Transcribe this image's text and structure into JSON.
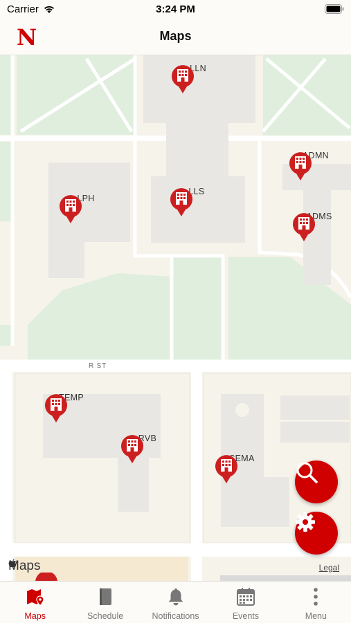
{
  "status_bar": {
    "carrier": "Carrier",
    "time": "3:24 PM"
  },
  "navbar": {
    "logo": "N",
    "title": "Maps"
  },
  "map": {
    "street_label": "R ST",
    "brand": "Maps",
    "legal": "Legal",
    "pins": [
      {
        "label": "LLN",
        "icon": "building-icon"
      },
      {
        "label": "LPH",
        "icon": "building-icon"
      },
      {
        "label": "LLS",
        "icon": "building-icon"
      },
      {
        "label": "ADMN",
        "icon": "building-icon"
      },
      {
        "label": "ADMS",
        "icon": "building-icon"
      },
      {
        "label": "TEMP",
        "icon": "building-icon"
      },
      {
        "label": "RVB",
        "icon": "building-icon"
      },
      {
        "label": "CEMA",
        "icon": "building-icon"
      }
    ],
    "buttons": {
      "search": "search-icon",
      "settings": "gear-icon"
    }
  },
  "tabs": [
    {
      "label": "Maps",
      "icon": "map-pin-icon",
      "active": true
    },
    {
      "label": "Schedule",
      "icon": "book-icon",
      "active": false
    },
    {
      "label": "Notifications",
      "icon": "bell-icon",
      "active": false
    },
    {
      "label": "Events",
      "icon": "calendar-icon",
      "active": false
    },
    {
      "label": "Menu",
      "icon": "more-vertical-icon",
      "active": false
    }
  ],
  "colors": {
    "accent": "#d00000",
    "park": "#dfeedd",
    "building": "#e8e7e3",
    "road": "#ffffff"
  }
}
